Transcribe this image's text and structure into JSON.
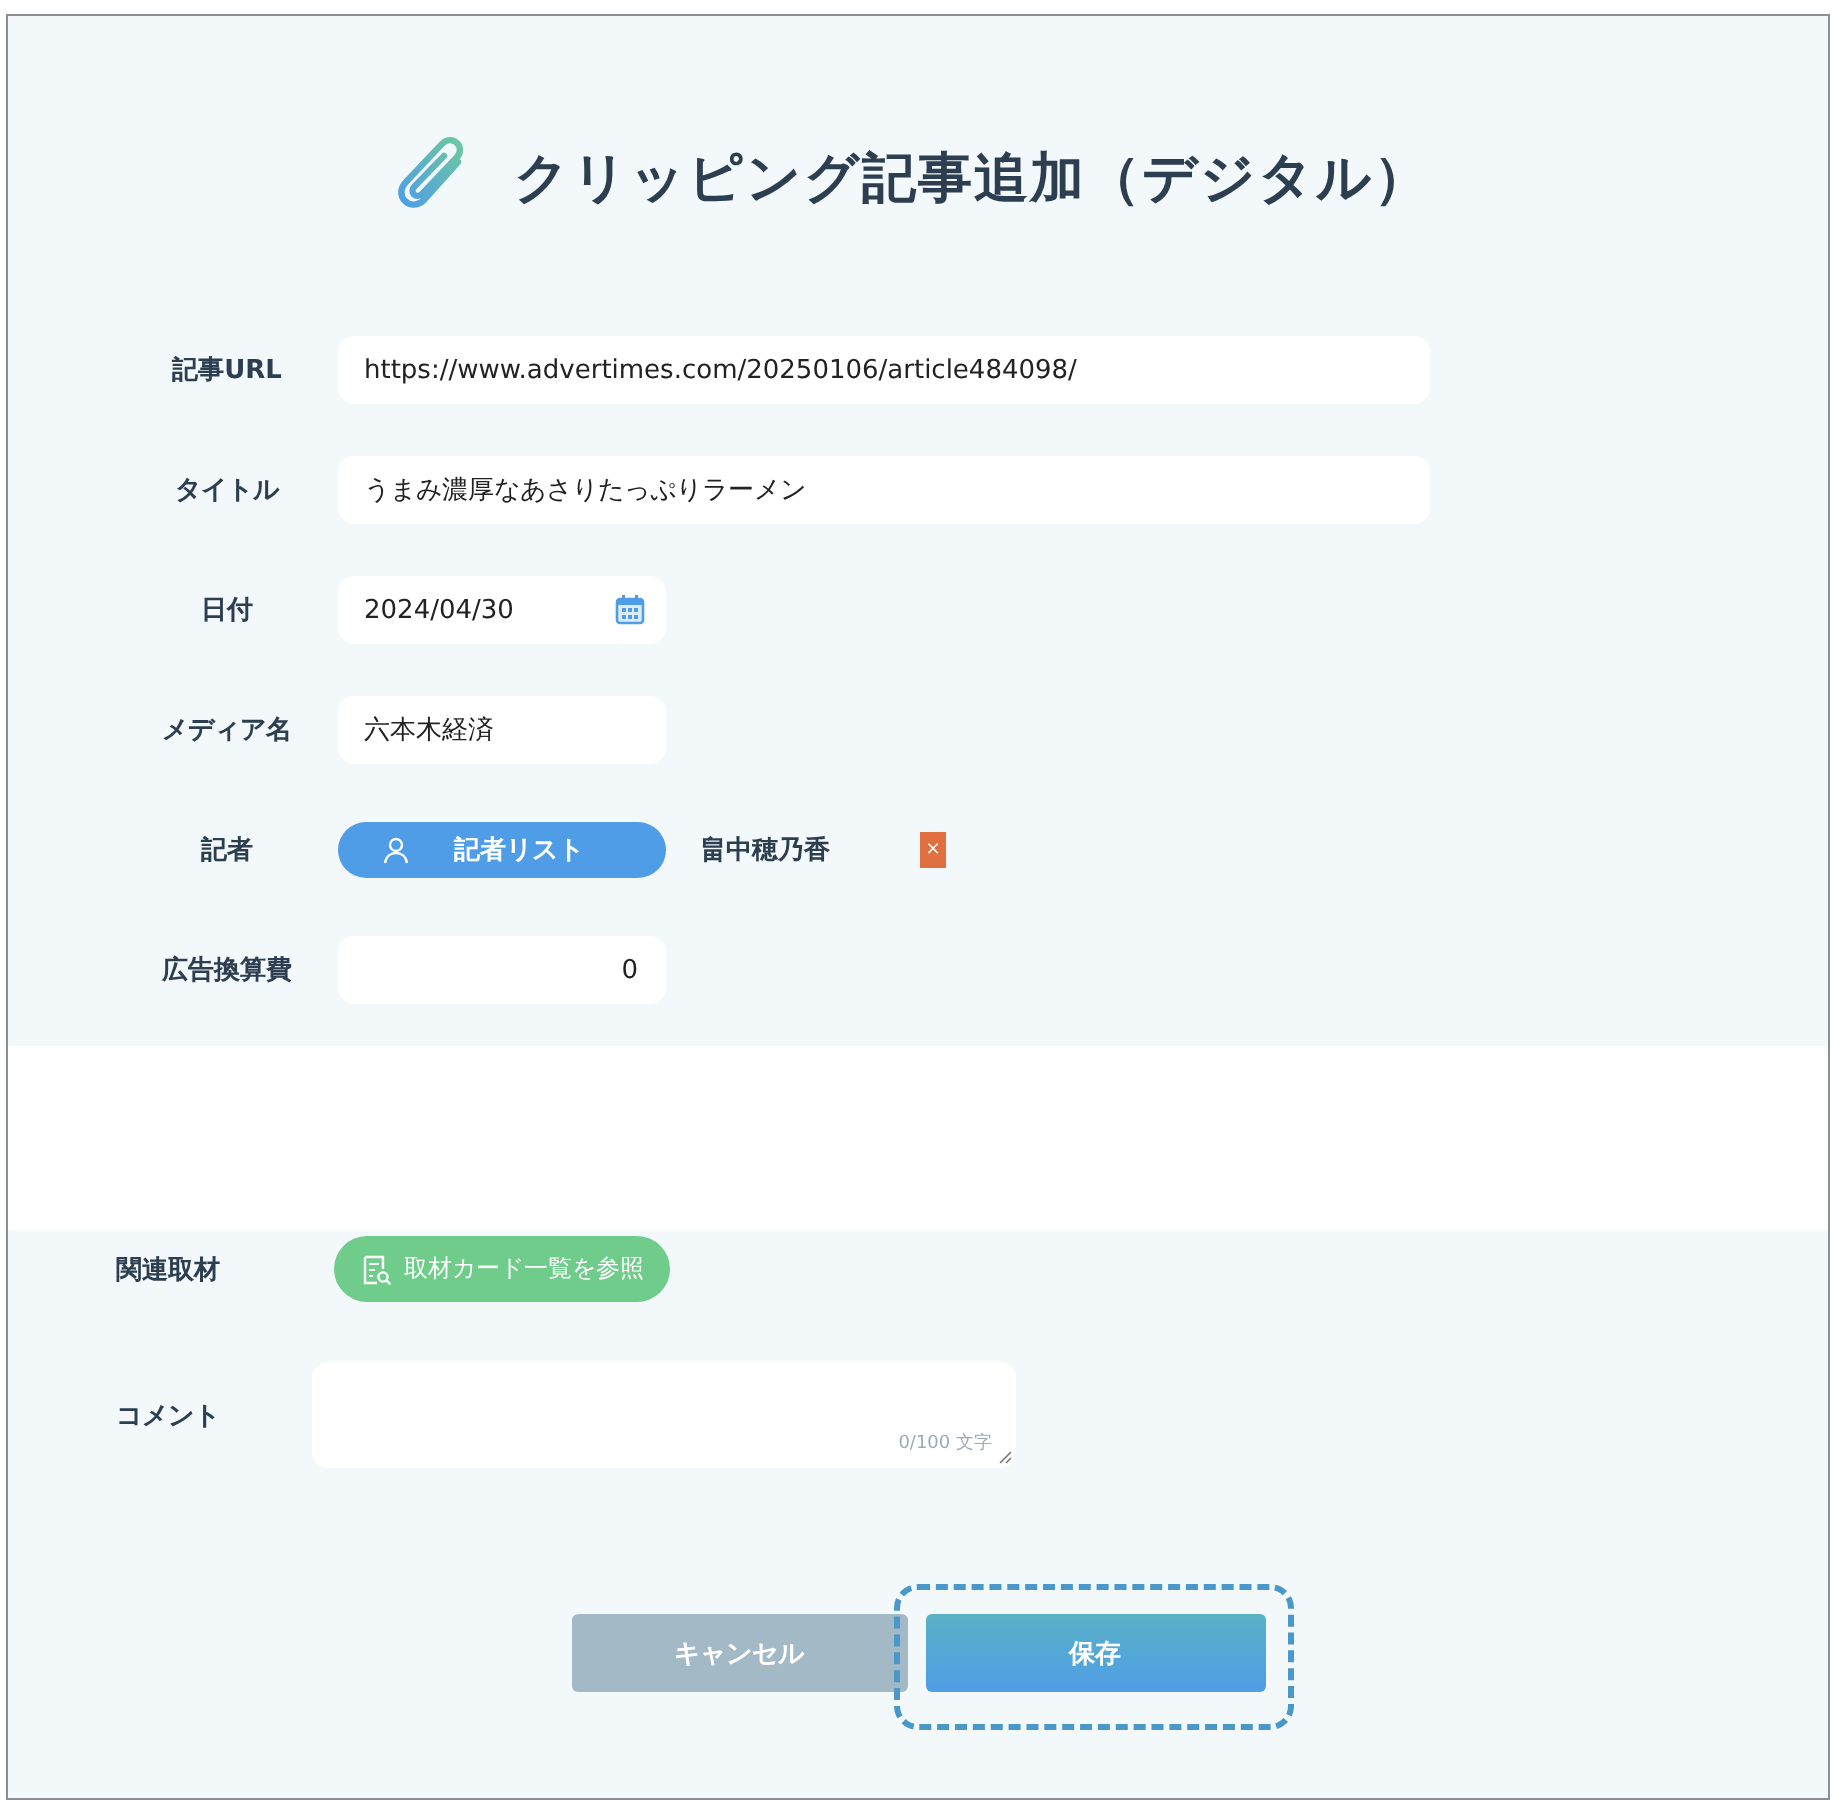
{
  "title": "クリッピング記事追加（デジタル）",
  "fields": [
    {
      "kind": "text",
      "label": "記事URL",
      "value": "https://www.advertimes.com/20250106/article484098/"
    },
    {
      "kind": "text",
      "label": "タイトル",
      "value": "うまみ濃厚なあさりたっぷりラーメン"
    },
    {
      "kind": "date",
      "label": "日付",
      "value": "2024/04/30"
    },
    {
      "kind": "short",
      "label": "メディア名",
      "value": "六本木経済"
    },
    {
      "kind": "reporter",
      "label": "記者",
      "button": "記者リスト",
      "name": "畠中穂乃香",
      "remove": "×"
    },
    {
      "kind": "number",
      "label": "広告換算費",
      "value": "0"
    }
  ],
  "lower_fields": [
    {
      "kind": "link",
      "label": "関連取材",
      "button": "取材カード一覧を参照"
    },
    {
      "kind": "textarea",
      "label": "コメント",
      "counter": "0/100 文字"
    }
  ],
  "buttons": [
    {
      "kind": "cancel",
      "label": "キャンセル",
      "focused": false
    },
    {
      "kind": "save",
      "label": "保存",
      "focused": true
    }
  ]
}
